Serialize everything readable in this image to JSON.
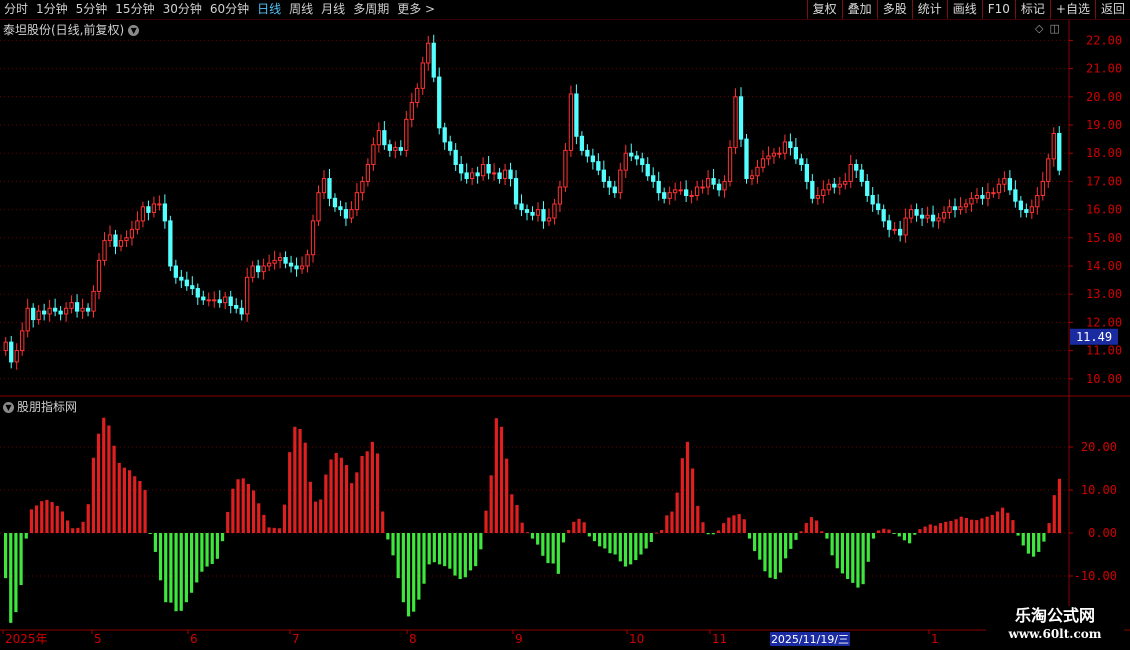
{
  "toolbar": {
    "periods": [
      "分时",
      "1分钟",
      "5分钟",
      "15分钟",
      "30分钟",
      "60分钟",
      "日线",
      "周线",
      "月线",
      "多周期",
      "更多 >"
    ],
    "active_period": "日线",
    "buttons": [
      "复权",
      "叠加",
      "多股",
      "统计",
      "画线",
      "F10",
      "标记",
      "+自选",
      "返回"
    ]
  },
  "stock": {
    "title": "泰坦股份(日线,前复权)",
    "corner_icons": [
      "diamond-icon",
      "layout-icon"
    ]
  },
  "price_axis": {
    "ticks": [
      "22.00",
      "21.00",
      "20.00",
      "19.00",
      "18.00",
      "17.00",
      "16.00",
      "15.00",
      "14.00",
      "13.00",
      "12.00",
      "11.00",
      "10.00"
    ],
    "current_price": "11.49"
  },
  "indicator": {
    "title": "股朋指标网",
    "ticks": [
      "20.00",
      "10.00",
      "0.00",
      "-10.00"
    ]
  },
  "date_axis": {
    "labels": [
      "2025年",
      "5",
      "6",
      "7",
      "8",
      "9",
      "10",
      "11",
      "1"
    ],
    "cursor_date": "2025/11/19/三"
  },
  "watermark": {
    "name": "乐淘公式网",
    "url": "www.60lt.com"
  },
  "colors": {
    "up": "#ff3232",
    "down": "#54ffff",
    "bar_pos": "#e02020",
    "bar_neg": "#3ee63e",
    "grid": "#6a0000",
    "accent": "#4fc3f7"
  },
  "chart_data": [
    {
      "type": "candlestick",
      "title": "泰坦股份(日线,前复权)",
      "ylim": [
        9.6,
        22.2
      ],
      "closes": [
        11.3,
        10.6,
        11.0,
        11.7,
        12.5,
        12.1,
        12.4,
        12.3,
        12.5,
        12.4,
        12.3,
        12.5,
        12.7,
        12.4,
        12.5,
        12.4,
        13.1,
        14.2,
        14.9,
        15.1,
        14.7,
        14.9,
        15.0,
        15.3,
        15.6,
        16.1,
        15.9,
        16.2,
        16.2,
        15.6,
        14.0,
        13.6,
        13.5,
        13.3,
        13.2,
        12.9,
        12.8,
        12.8,
        12.8,
        12.7,
        12.9,
        12.6,
        12.5,
        12.3,
        13.6,
        14.0,
        13.8,
        14.0,
        14.1,
        14.2,
        14.3,
        14.1,
        14.0,
        13.9,
        14.0,
        14.4,
        15.6,
        16.6,
        17.1,
        16.4,
        16.1,
        16.0,
        15.7,
        16.0,
        16.6,
        17.0,
        17.6,
        18.3,
        18.8,
        18.3,
        18.1,
        18.2,
        18.1,
        19.2,
        19.8,
        20.3,
        21.2,
        21.9,
        20.7,
        18.9,
        18.4,
        18.1,
        17.6,
        17.3,
        17.1,
        17.3,
        17.2,
        17.6,
        17.3,
        17.3,
        17.1,
        17.4,
        17.1,
        16.2,
        16.0,
        15.9,
        15.8,
        16.0,
        15.6,
        15.7,
        16.2,
        16.8,
        18.1,
        20.1,
        18.6,
        18.1,
        17.9,
        17.7,
        17.4,
        17.0,
        16.8,
        16.6,
        17.4,
        18.0,
        17.9,
        17.8,
        17.6,
        17.2,
        17.0,
        16.6,
        16.4,
        16.6,
        16.7,
        16.7,
        16.5,
        16.5,
        16.8,
        16.8,
        17.1,
        16.9,
        16.7,
        17.0,
        18.2,
        20.0,
        18.5,
        17.1,
        17.2,
        17.5,
        17.8,
        17.9,
        18.0,
        18.0,
        18.4,
        18.2,
        17.8,
        17.6,
        17.0,
        16.4,
        16.5,
        16.7,
        16.9,
        16.8,
        16.9,
        17.0,
        17.6,
        17.4,
        17.0,
        16.5,
        16.2,
        16.0,
        15.6,
        15.3,
        15.3,
        15.1,
        15.7,
        16.0,
        15.8,
        15.7,
        15.8,
        15.6,
        15.7,
        15.9,
        16.1,
        16.0,
        16.1,
        16.2,
        16.4,
        16.5,
        16.4,
        16.6,
        16.6,
        16.9,
        17.1,
        16.7,
        16.3,
        16.0,
        15.9,
        16.1,
        16.5,
        17.0,
        17.8,
        18.7,
        17.4
      ],
      "last_price": 11.49
    },
    {
      "type": "bar",
      "title": "股朋指标网",
      "ylim": [
        -21,
        27
      ],
      "values": [
        -10.5,
        -20.9,
        -18.4,
        -12.1,
        -1.3,
        5.5,
        6.4,
        7.4,
        7.7,
        7.2,
        6.3,
        5.0,
        2.9,
        1.1,
        1.2,
        2.6,
        6.7,
        17.5,
        23.1,
        26.8,
        25.0,
        20.3,
        16.3,
        15.2,
        14.6,
        13.2,
        12.1,
        10.0,
        -0.2,
        -4.4,
        -11.0,
        -16.1,
        -16.2,
        -18.2,
        -18.1,
        -16.1,
        -13.9,
        -11.5,
        -9.0,
        -7.8,
        -7.2,
        -6.0,
        -1.9,
        4.9,
        10.3,
        12.5,
        12.7,
        11.4,
        9.9,
        6.9,
        4.2,
        1.3,
        1.2,
        1.1,
        6.6,
        18.8,
        24.7,
        24.2,
        21.0,
        11.9,
        7.3,
        7.8,
        13.6,
        17.1,
        18.6,
        17.5,
        15.8,
        11.6,
        14.1,
        17.9,
        19.0,
        21.2,
        18.5,
        5.0,
        -1.5,
        -5.2,
        -10.5,
        -16.1,
        -19.4,
        -18.3,
        -15.5,
        -11.8,
        -7.3,
        -6.8,
        -7.3,
        -7.7,
        -8.3,
        -9.9,
        -10.7,
        -10.3,
        -8.7,
        -7.7,
        -3.8,
        5.2,
        13.4,
        26.7,
        24.7,
        17.3,
        9.0,
        6.5,
        2.4,
        0.2,
        -1.3,
        -2.7,
        -5.3,
        -7.0,
        -7.1,
        -9.5,
        -2.2,
        0.7,
        2.6,
        3.3,
        2.5,
        -0.8,
        -1.9,
        -3.1,
        -3.6,
        -4.7,
        -5.0,
        -6.6,
        -7.8,
        -7.3,
        -6.3,
        -5.0,
        -3.6,
        -2.1,
        0.1,
        0.7,
        4.1,
        5.0,
        9.4,
        17.4,
        21.2,
        15.0,
        6.3,
        2.5,
        -0.3,
        -0.3,
        0.6,
        2.3,
        3.6,
        4.1,
        4.4,
        3.2,
        -1.3,
        -4.2,
        -6.2,
        -8.9,
        -10.4,
        -10.7,
        -9.2,
        -5.9,
        -3.7,
        -1.6,
        0.4,
        2.3,
        3.7,
        2.9,
        0.4,
        -1.3,
        -5.2,
        -8.2,
        -9.4,
        -10.7,
        -11.6,
        -12.7,
        -11.9,
        -6.7,
        -1.3,
        0.6,
        1.0,
        0.8,
        -0.1,
        -0.8,
        -1.7,
        -2.4,
        -0.4,
        0.9,
        1.5,
        2.0,
        1.7,
        2.3,
        2.6,
        2.8,
        3.2,
        3.8,
        3.5,
        3.1,
        3.0,
        3.4,
        3.8,
        4.2,
        5.0,
        5.9,
        4.7,
        3.0,
        -0.6,
        -2.9,
        -4.8,
        -5.5,
        -4.4,
        -2.0,
        2.3,
        8.8,
        12.6
      ]
    }
  ]
}
